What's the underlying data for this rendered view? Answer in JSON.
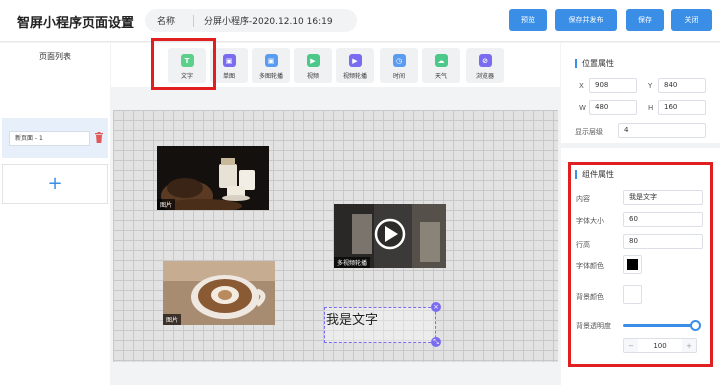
{
  "header": {
    "title": "智屏小程序页面设置",
    "name_label": "名称",
    "name_value": "分屏小程序-2020.12.10 16:19",
    "buttons": {
      "preview": "预览",
      "save_publish": "保存并发布",
      "save": "保存",
      "close": "关闭"
    }
  },
  "sidebar": {
    "title": "页面列表",
    "pages": [
      {
        "name": "新页面 - 1"
      }
    ],
    "add_label": "+"
  },
  "toolbar": {
    "tools": [
      {
        "label": "文字",
        "icon": "text-icon",
        "color": "#5ccf8a",
        "glyph": "T"
      },
      {
        "label": "单图",
        "icon": "image-icon",
        "color": "#7a6cf0",
        "glyph": "▣"
      },
      {
        "label": "多图轮播",
        "icon": "carousel-icon",
        "color": "#5b9cf0",
        "glyph": "▣"
      },
      {
        "label": "视频",
        "icon": "video-icon",
        "color": "#4cc98a",
        "glyph": "▶"
      },
      {
        "label": "视频轮播",
        "icon": "video-carousel-icon",
        "color": "#7a6cf0",
        "glyph": "▶"
      },
      {
        "label": "时间",
        "icon": "clock-icon",
        "color": "#5b9cf0",
        "glyph": "◷"
      },
      {
        "label": "天气",
        "icon": "weather-icon",
        "color": "#4cc98a",
        "glyph": "☁"
      },
      {
        "label": "浏览器",
        "icon": "browser-icon",
        "color": "#7a6cf0",
        "glyph": "⊘"
      }
    ]
  },
  "canvas": {
    "image_tag": "图片",
    "video_tag": "多视频轮播",
    "text_widget": "我是文字"
  },
  "position": {
    "title": "位置属性",
    "x_label": "X",
    "x": "908",
    "y_label": "Y",
    "y": "840",
    "w_label": "W",
    "w": "480",
    "h_label": "H",
    "h": "160",
    "layer_label": "显示层级",
    "layer": "4"
  },
  "component": {
    "title": "组件属性",
    "content_label": "内容",
    "content": "我是文字",
    "font_size_label": "字体大小",
    "font_size": "60",
    "line_height_label": "行高",
    "line_height": "80",
    "font_color_label": "字体颜色",
    "font_color": "#000000",
    "bg_color_label": "背景颜色",
    "bg_color": "#ffffff",
    "bg_opacity_label": "背景透明度",
    "bg_opacity": "100",
    "stepper_minus": "−",
    "stepper_plus": "+"
  },
  "colors": {
    "accent": "#3a8ee6",
    "highlight": "#e02020",
    "selection": "#7a6cf0"
  }
}
